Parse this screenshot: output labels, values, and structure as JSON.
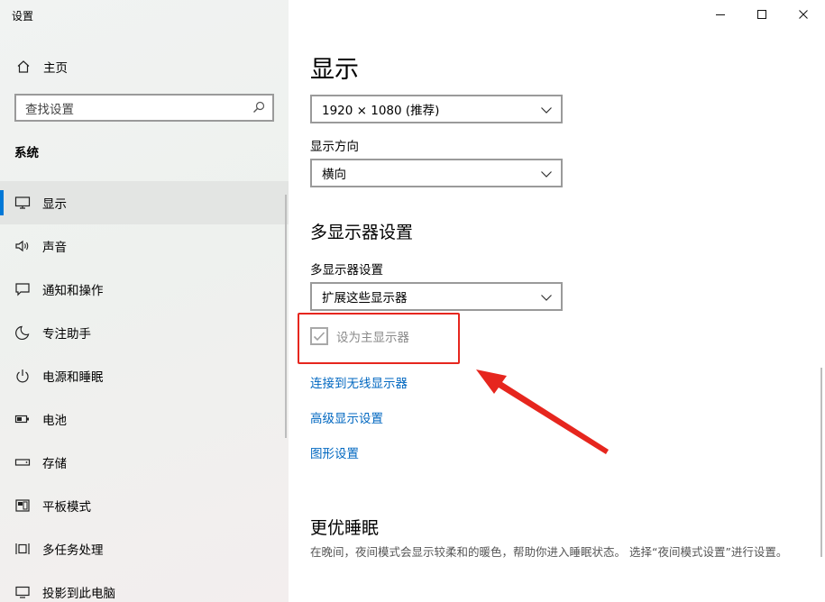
{
  "window": {
    "title": "设置"
  },
  "sidebar": {
    "home_label": "主页",
    "search_placeholder": "查找设置",
    "section_label": "系统",
    "items": [
      {
        "label": "显示",
        "icon": "monitor-icon",
        "selected": true
      },
      {
        "label": "声音",
        "icon": "speaker-icon"
      },
      {
        "label": "通知和操作",
        "icon": "notification-icon"
      },
      {
        "label": "专注助手",
        "icon": "moon-icon"
      },
      {
        "label": "电源和睡眠",
        "icon": "power-icon"
      },
      {
        "label": "电池",
        "icon": "battery-icon"
      },
      {
        "label": "存储",
        "icon": "storage-icon"
      },
      {
        "label": "平板模式",
        "icon": "tablet-icon"
      },
      {
        "label": "多任务处理",
        "icon": "multitask-icon"
      },
      {
        "label": "投影到此电脑",
        "icon": "project-icon"
      }
    ]
  },
  "main": {
    "title": "显示",
    "resolution_value": "1920 × 1080 (推荐)",
    "orientation_label": "显示方向",
    "orientation_value": "横向",
    "multi_display_heading": "多显示器设置",
    "multi_display_label": "多显示器设置",
    "multi_display_value": "扩展这些显示器",
    "primary_checkbox_label": "设为主显示器",
    "primary_checkbox_checked": true,
    "primary_checkbox_disabled": true,
    "links": {
      "wireless": "连接到无线显示器",
      "advanced": "高级显示设置",
      "graphics": "图形设置"
    },
    "sleep_heading": "更优睡眠",
    "sleep_description": "在晚间，夜间模式会显示较柔和的暖色，帮助你进入睡眠状态。 选择“夜间模式设置”进行设置。"
  },
  "colors": {
    "accent": "#0078d7",
    "link": "#0067c0",
    "annotation": "#e6261e"
  }
}
